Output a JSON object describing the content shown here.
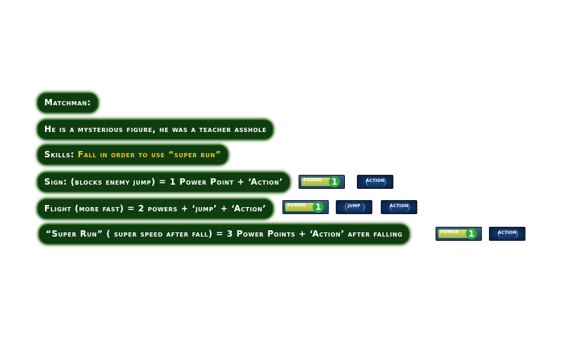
{
  "lines": {
    "name": "Matchman:",
    "description": "He is a mysterious figure, he was a teacher asshole",
    "skills_label": "Skills:",
    "skills_value": "Fall in order to use “super run”",
    "sign": "Sign: (blocks enemy jump) = 1 Power Point + ‘Action’",
    "flight": "Flight (more fast) = 2 powers + ‘jump’ + ‘Action’",
    "super_run": "“Super Run” ( super speed after fall) = 3 Power Points + ‘Action’ after falling"
  },
  "badges": {
    "power_label": "POWER",
    "action_label": "ACTION",
    "jump_label": "JUMP",
    "sign_power_value": "1",
    "flight_power_value": "1",
    "super_run_power_value": "1"
  },
  "colors": {
    "pill_bg": "#0f3d10",
    "glow": "#2f6b20",
    "accent": "#f2c21b",
    "power_number": "#2ea83a"
  }
}
